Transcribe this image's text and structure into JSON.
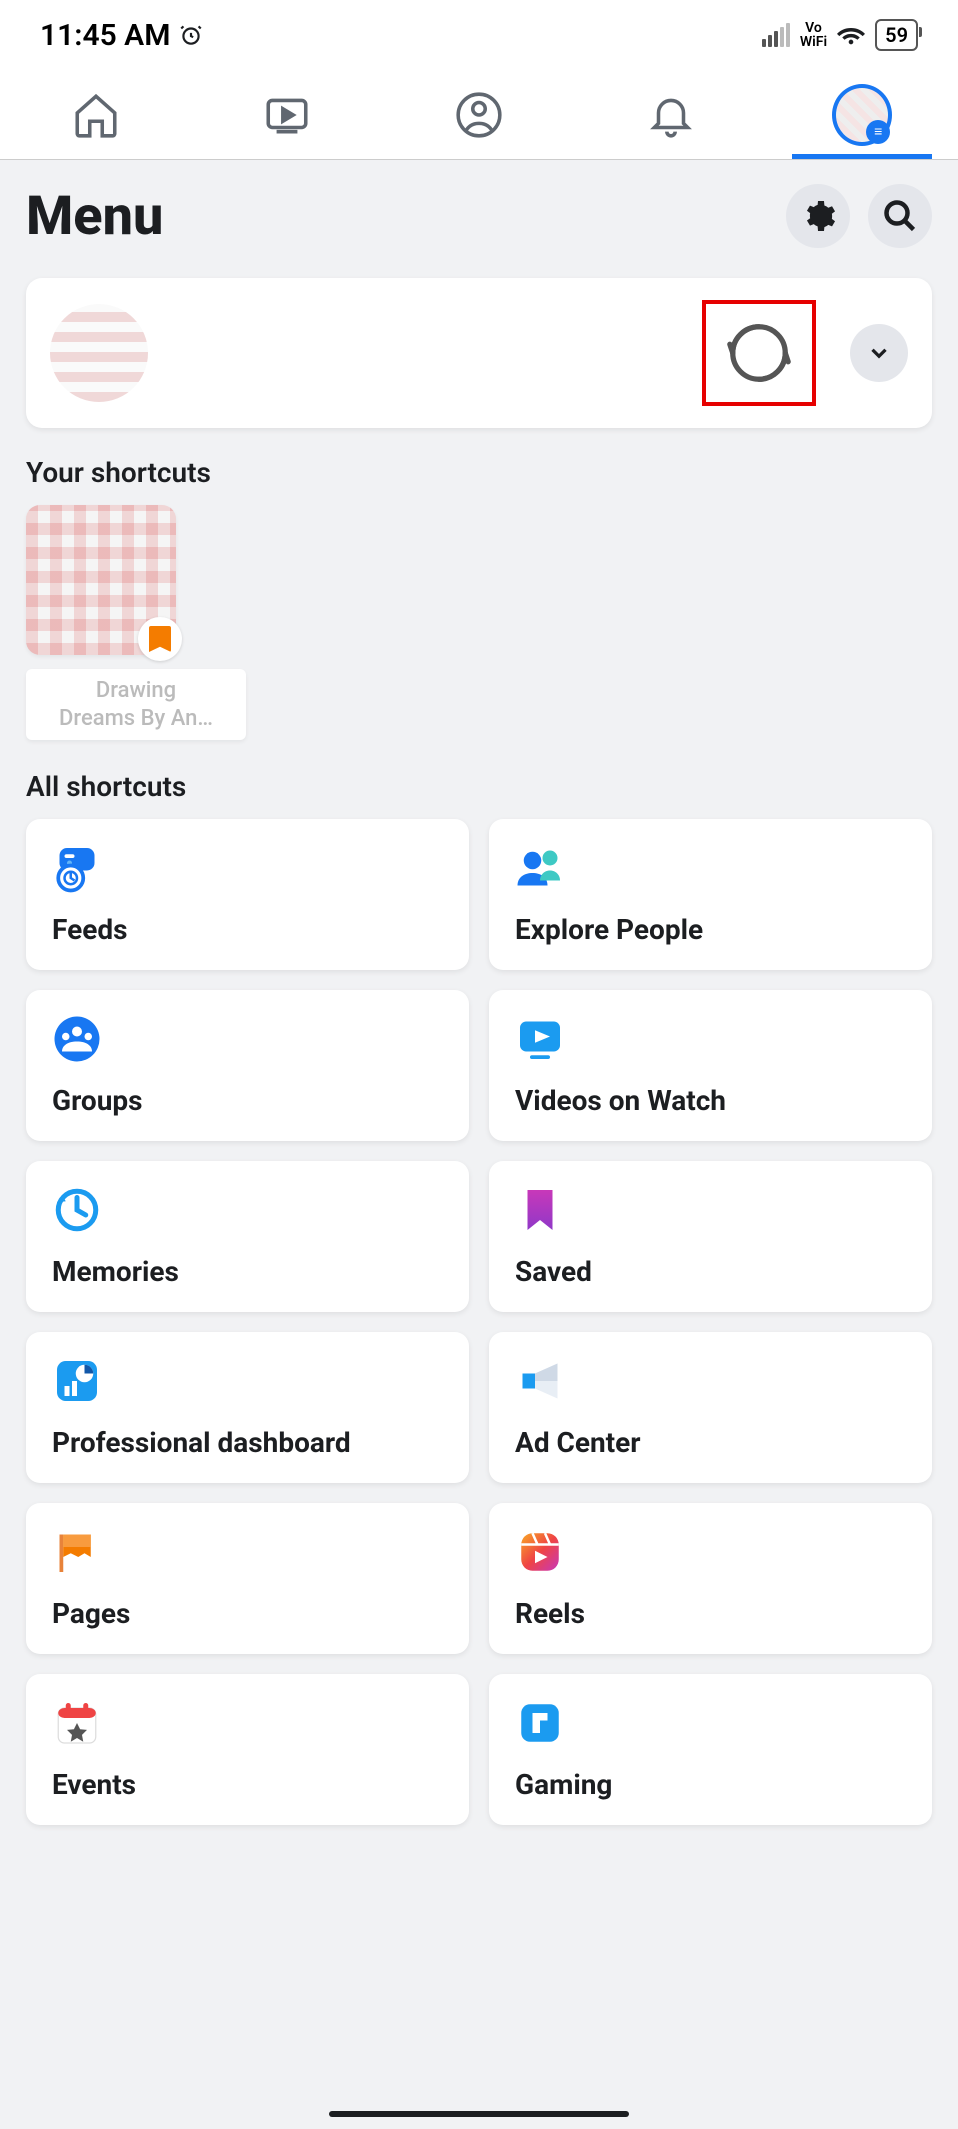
{
  "status": {
    "time": "11:45 AM",
    "battery": "59",
    "net_label": "Vo\nWiFi"
  },
  "tabs_active": "menu",
  "header": {
    "title": "Menu"
  },
  "profile": {
    "name": ""
  },
  "shortcuts_heading": "Your shortcuts",
  "shortcut": {
    "label_line1": "Drawing",
    "label_line2": "Dreams By An…"
  },
  "all_heading": "All shortcuts",
  "tiles": [
    {
      "label": "Feeds",
      "icon": "feeds"
    },
    {
      "label": "Explore People",
      "icon": "people"
    },
    {
      "label": "Groups",
      "icon": "groups"
    },
    {
      "label": "Videos on Watch",
      "icon": "watch"
    },
    {
      "label": "Memories",
      "icon": "memories"
    },
    {
      "label": "Saved",
      "icon": "saved"
    },
    {
      "label": "Professional dashboard",
      "icon": "dashboard"
    },
    {
      "label": "Ad Center",
      "icon": "adcenter"
    },
    {
      "label": "Pages",
      "icon": "pages"
    },
    {
      "label": "Reels",
      "icon": "reels"
    },
    {
      "label": "Events",
      "icon": "events"
    },
    {
      "label": "Gaming",
      "icon": "gaming"
    }
  ],
  "colors": {
    "accent": "#1877f2",
    "highlight_box": "#e60000"
  }
}
